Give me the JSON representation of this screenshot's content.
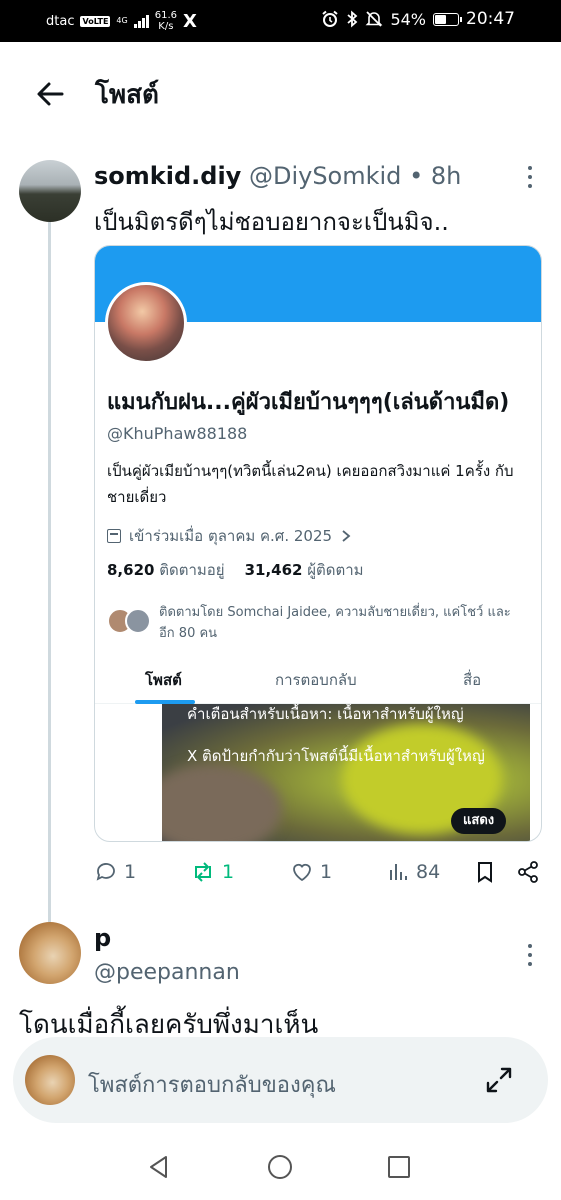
{
  "status_bar": {
    "carrier": "dtac",
    "volte": "VoLTE",
    "network": "4G",
    "net_speed_value": "61.6",
    "net_speed_unit": "K/s",
    "app_glyph": "X",
    "battery": "54%",
    "battery_level": 0.54,
    "time": "20:47",
    "icons": [
      "alarm-icon",
      "bluetooth-icon",
      "mute-icon",
      "battery-icon"
    ]
  },
  "header": {
    "title": "โพสต์",
    "back_icon": "arrow-left-icon"
  },
  "post": {
    "display_name": "somkid.diy",
    "handle": "@DiySomkid",
    "separator": "•",
    "time": "8h",
    "text": "เป็นมิตรดีๆไม่ชอบอยากจะเป็นมิจ.."
  },
  "quoted_profile": {
    "name": "แมนกับฝน...คู่ผัวเมียบ้านๆๆๆ(เล่นด้านมืด)",
    "handle": "@KhuPhaw88188",
    "bio": "เป็นคู่ผัวเมียบ้านๆๆ(ทวิตนี้เล่น2คน) เคยออกสวิงมาแค่ 1ครั้ง กับชายเดี่ยว",
    "joined": "เข้าร่วมเมื่อ ตุลาคม ค.ศ. 2025",
    "following_count": "8,620",
    "following_label": "ติดตามอยู่",
    "followers_count": "31,462",
    "followers_label": "ผู้ติดตาม",
    "followed_by": "ติดตามโดย Somchai Jaidee, ความลับชายเดี่ยว, แค่โชว์ และ อีก 80 คน",
    "tabs": [
      "โพสต์",
      "การตอบกลับ",
      "สื่อ"
    ],
    "active_tab": "โพสต์",
    "media_warning_title": "คำเตือนสำหรับเนื้อหา: เนื้อหาสำหรับผู้ใหญ่",
    "media_warning_text": "X ติดป้ายกำกับว่าโพสต์นี้มีเนื้อหาสำหรับผู้ใหญ่",
    "show_button": "แสดง",
    "banner_color": "#1d9bf0"
  },
  "actions": {
    "replies": "1",
    "reposts": "1",
    "likes": "1",
    "views": "84",
    "repost_color": "#00ba7c"
  },
  "reply_post": {
    "display_name": "p",
    "handle": "@peepannan",
    "text": "โดนเมื่อกี้เลยครับพึ่งมาเห็น"
  },
  "composer": {
    "placeholder": "โพสต์การตอบกลับของคุณ"
  },
  "colors": {
    "text_primary": "#0f1419",
    "text_secondary": "#536471",
    "accent": "#1d9bf0",
    "border": "#cfd9de"
  }
}
